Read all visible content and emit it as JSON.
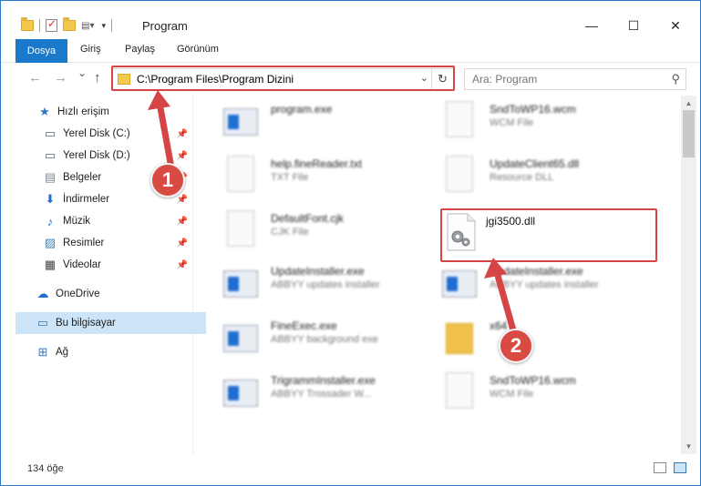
{
  "window": {
    "title": "Program",
    "minimize": "—",
    "maximize": "☐",
    "close": "✕"
  },
  "ribbon": {
    "tabs": [
      "Dosya",
      "Giriş",
      "Paylaş",
      "Görünüm"
    ]
  },
  "nav": {
    "back": "←",
    "forward": "→",
    "recent": "⌄",
    "up": "↑",
    "address": "C:\\Program Files\\Program Dizini",
    "search_placeholder": "Ara: Program"
  },
  "sidebar": {
    "items": [
      {
        "label": "Hızlı erişim",
        "icon": "star-icon"
      },
      {
        "label": "Yerel Disk (C:)",
        "icon": "drive-icon",
        "pinned": true
      },
      {
        "label": "Yerel Disk (D:)",
        "icon": "drive-icon",
        "pinned": true
      },
      {
        "label": "Belgeler",
        "icon": "documents-icon",
        "pinned": true
      },
      {
        "label": "İndirmeler",
        "icon": "download-icon",
        "pinned": true
      },
      {
        "label": "Müzik",
        "icon": "music-icon",
        "pinned": true
      },
      {
        "label": "Resimler",
        "icon": "pictures-icon",
        "pinned": true
      },
      {
        "label": "Videolar",
        "icon": "videos-icon",
        "pinned": true
      },
      {
        "label": "OneDrive",
        "icon": "cloud-icon"
      },
      {
        "label": "Bu bilgisayar",
        "icon": "computer-icon",
        "selected": true
      },
      {
        "label": "Ağ",
        "icon": "network-icon"
      }
    ]
  },
  "files": [
    {
      "name": "program.exe",
      "type": "",
      "kind": "app"
    },
    {
      "name": "SndToWP16.wcm",
      "type": "WCM File",
      "kind": "doc"
    },
    {
      "name": "help.fineReader.txt",
      "type": "TXT File",
      "kind": "doc"
    },
    {
      "name": "UpdateClient65.dll",
      "type": "Resource DLL",
      "kind": "doc"
    },
    {
      "name": "DefaultFont.cjk",
      "type": "CJK File",
      "kind": "doc"
    },
    {
      "name": "jgi3500.dll",
      "type": "",
      "kind": "dll"
    },
    {
      "name": "UpdateInstaller.exe",
      "type": "ABBYY updates installer",
      "kind": "app"
    },
    {
      "name": "UpdateInstaller.exe",
      "type": "ABBYY updates installer",
      "kind": "app"
    },
    {
      "name": "FineExec.exe",
      "type": "ABBYY background exe",
      "kind": "app"
    },
    {
      "name": "x64",
      "type": "",
      "kind": "folder"
    },
    {
      "name": "TrigrammInstaller.exe",
      "type": "ABBYY Trossader W...",
      "kind": "app"
    },
    {
      "name": "SndToWP16.wcm",
      "type": "WCM File",
      "kind": "doc"
    }
  ],
  "annotations": {
    "step1": "1",
    "step2": "2",
    "color": "#d64545"
  },
  "status": {
    "count": "134 öğe"
  }
}
